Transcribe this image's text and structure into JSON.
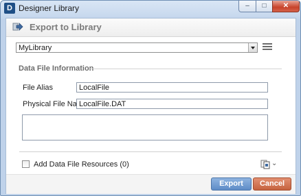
{
  "window": {
    "app_logo": "D",
    "title": "Designer Library",
    "controls": {
      "minimize": "–",
      "maximize": "□",
      "close": "✕"
    }
  },
  "header": {
    "title": "Export to Library",
    "icon": "export-arrow-icon"
  },
  "library_select": {
    "value": "MyLibrary"
  },
  "section": {
    "title": "Data File Information"
  },
  "fields": {
    "alias": {
      "label": "File Alias",
      "value": "LocalFile"
    },
    "physical": {
      "label": "Physical File Name",
      "value": "LocalFile.DAT"
    },
    "description": {
      "value": ""
    }
  },
  "resources": {
    "label": "Add Data File Resources (0)",
    "checked": false,
    "chevron": "⌄"
  },
  "buttons": {
    "export": "Export",
    "cancel": "Cancel"
  },
  "colors": {
    "export_button": "#5e8cc7",
    "cancel_button": "#c5623e",
    "close_button": "#c7432a"
  }
}
